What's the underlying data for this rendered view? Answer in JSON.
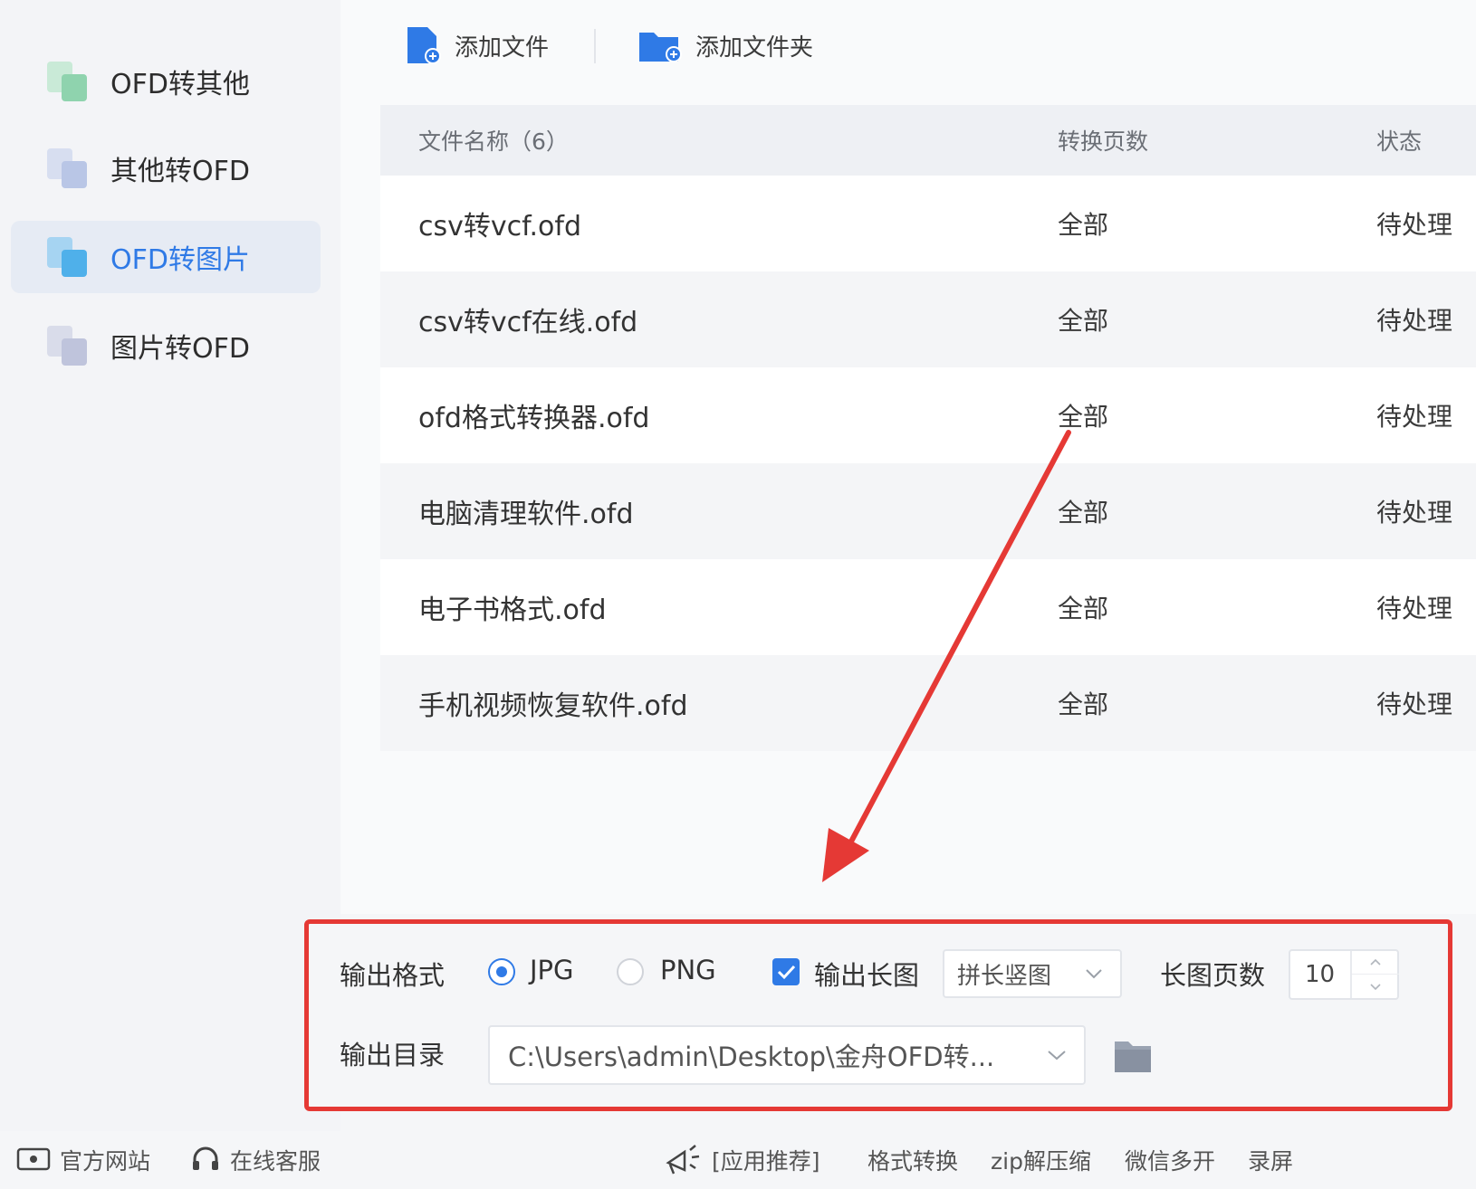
{
  "sidebar": {
    "items": [
      {
        "label": "OFD转其他",
        "icon": "ofd-to-other-icon",
        "active": false
      },
      {
        "label": "其他转OFD",
        "icon": "other-to-ofd-icon",
        "active": false
      },
      {
        "label": "OFD转图片",
        "icon": "ofd-to-image-icon",
        "active": true
      },
      {
        "label": "图片转OFD",
        "icon": "image-to-ofd-icon",
        "active": false
      }
    ]
  },
  "toolbar": {
    "add_file_label": "添加文件",
    "add_folder_label": "添加文件夹"
  },
  "table": {
    "headers": {
      "name": "文件名称（6）",
      "pages": "转换页数",
      "status": "状态"
    },
    "rows": [
      {
        "name": "csv转vcf.ofd",
        "pages": "全部",
        "status": "待处理"
      },
      {
        "name": "csv转vcf在线.ofd",
        "pages": "全部",
        "status": "待处理"
      },
      {
        "name": "ofd格式转换器.ofd",
        "pages": "全部",
        "status": "待处理"
      },
      {
        "name": "电脑清理软件.ofd",
        "pages": "全部",
        "status": "待处理"
      },
      {
        "name": "电子书格式.ofd",
        "pages": "全部",
        "status": "待处理"
      },
      {
        "name": "手机视频恢复软件.ofd",
        "pages": "全部",
        "status": "待处理"
      }
    ]
  },
  "settings": {
    "output_format_label": "输出格式",
    "format_jpg": "JPG",
    "format_png": "PNG",
    "selected_format": "JPG",
    "long_image_label": "输出长图",
    "long_image_checked": true,
    "long_image_mode": "拼长竖图",
    "long_image_pages_label": "长图页数",
    "long_image_pages_value": "10",
    "output_dir_label": "输出目录",
    "output_dir_value": "C:\\Users\\admin\\Desktop\\金舟OFD转..."
  },
  "bottombar": {
    "official_site": "官方网站",
    "online_service": "在线客服",
    "recommend": "[应用推荐]",
    "links": [
      "格式转换",
      "zip解压缩",
      "微信多开",
      "录屏"
    ]
  },
  "colors": {
    "accent": "#2f7ae6",
    "highlight_box": "#e53935",
    "annotation_arrow": "#e53935"
  }
}
